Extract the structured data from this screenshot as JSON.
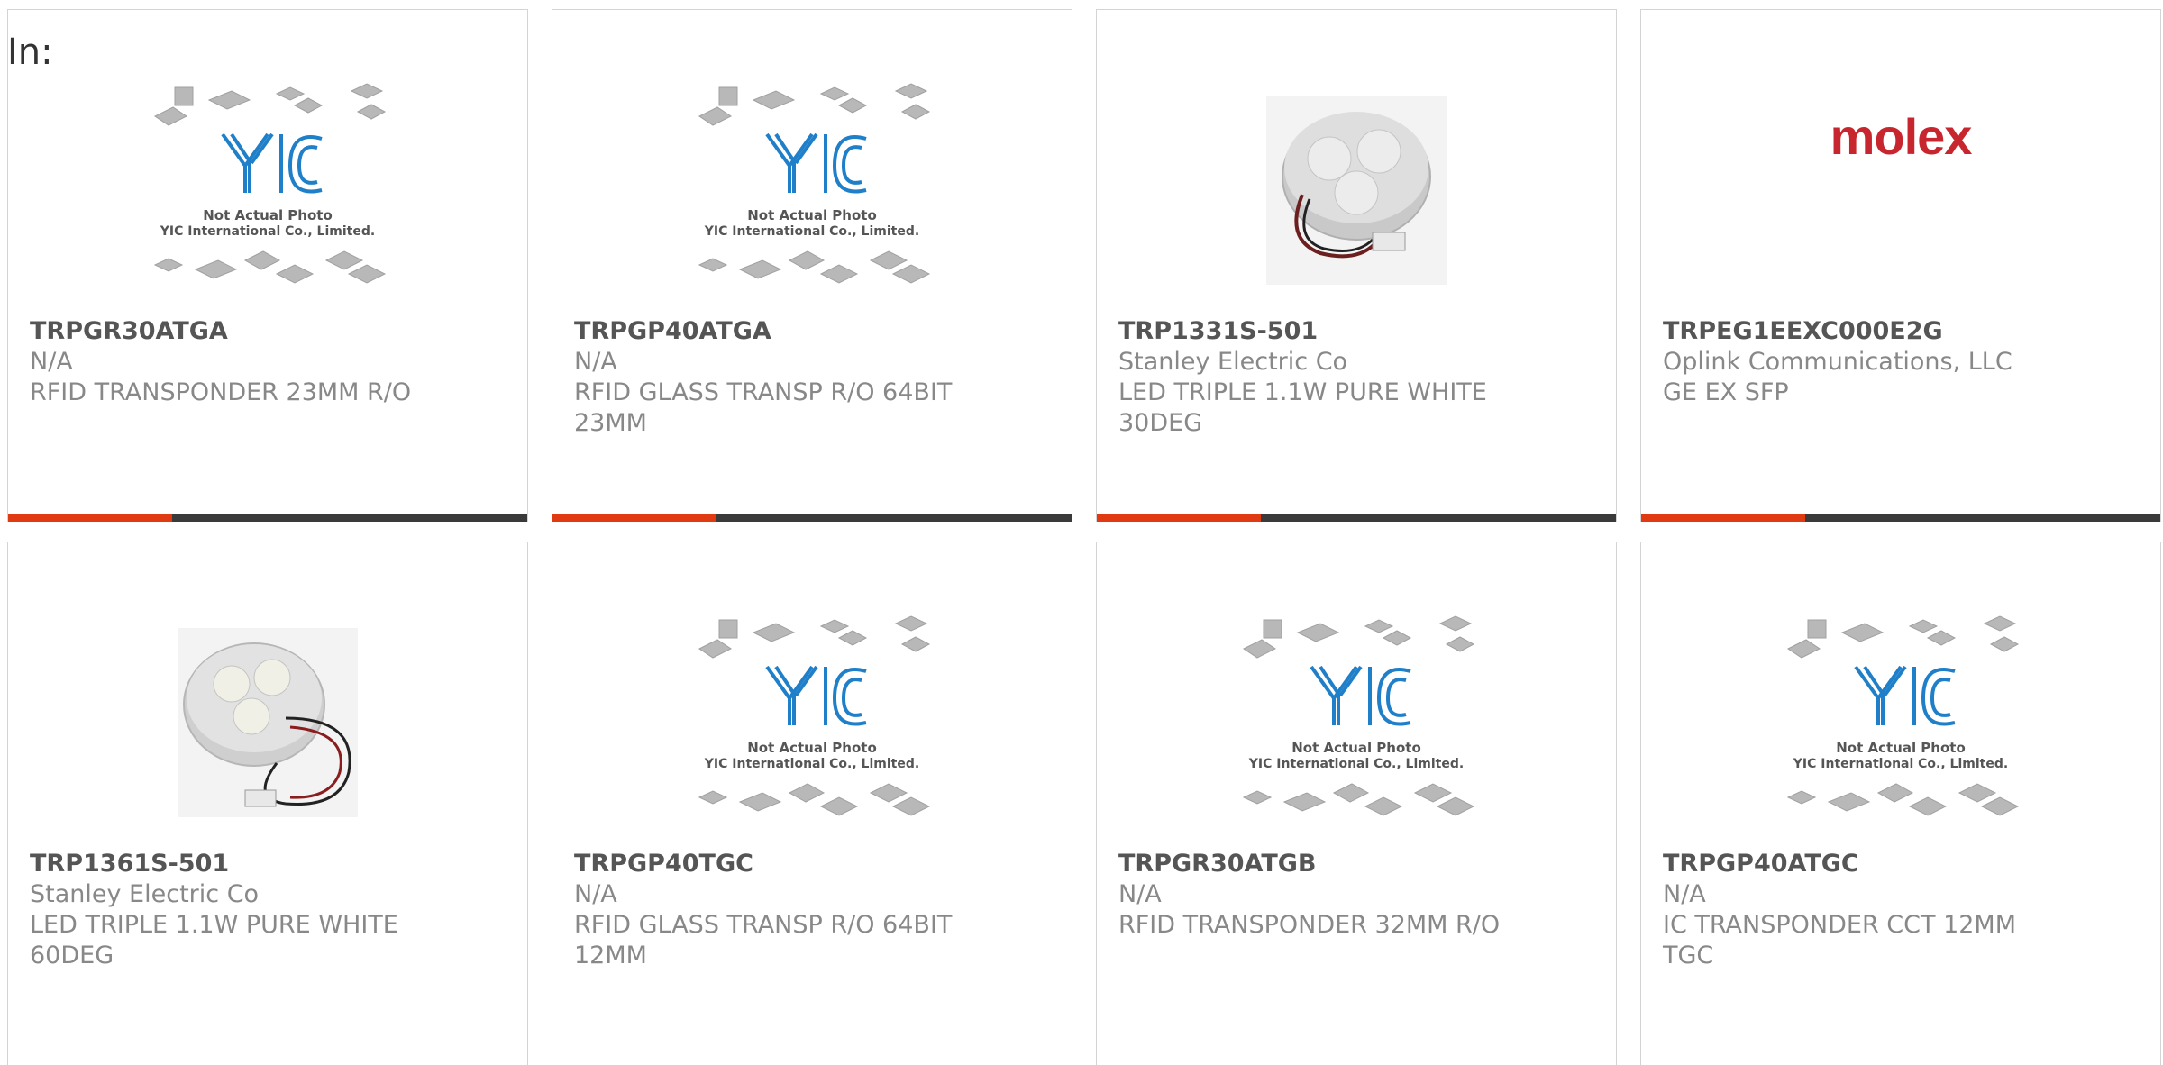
{
  "header": {
    "label": "In:"
  },
  "colors": {
    "accent": "#e03a12",
    "bar": "#3a3a3a",
    "molex_red": "#c8262e",
    "yic_blue": "#1f7fc8"
  },
  "placeholder_image": {
    "line1": "Not Actual Photo",
    "line2": "YIC International Co., Limited."
  },
  "products": [
    {
      "part": "TRPGR30ATGA",
      "manufacturer": "N/A",
      "desc1": "RFID TRANSPONDER 23MM R/O",
      "desc2": "",
      "image": "yic-placeholder"
    },
    {
      "part": "TRPGP40ATGA",
      "manufacturer": "N/A",
      "desc1": "RFID GLASS TRANSP R/O 64BIT",
      "desc2": "23MM",
      "image": "yic-placeholder"
    },
    {
      "part": "TRP1331S-501",
      "manufacturer": "Stanley Electric Co",
      "desc1": "LED TRIPLE 1.1W PURE WHITE",
      "desc2": "30DEG",
      "image": "led-module-photo"
    },
    {
      "part": "TRPEG1EEXC000E2G",
      "manufacturer": "Oplink Communications, LLC",
      "desc1": "GE EX SFP",
      "desc2": "",
      "image": "molex-logo",
      "logo_text": "molex"
    },
    {
      "part": "TRP1361S-501",
      "manufacturer": "Stanley Electric Co",
      "desc1": "LED TRIPLE 1.1W PURE WHITE",
      "desc2": "60DEG",
      "image": "led-module-photo"
    },
    {
      "part": "TRPGP40TGC",
      "manufacturer": "N/A",
      "desc1": "RFID GLASS TRANSP R/O 64BIT",
      "desc2": "12MM",
      "image": "yic-placeholder"
    },
    {
      "part": "TRPGR30ATGB",
      "manufacturer": "N/A",
      "desc1": "RFID TRANSPONDER 32MM R/O",
      "desc2": "",
      "image": "yic-placeholder"
    },
    {
      "part": "TRPGP40ATGC",
      "manufacturer": "N/A",
      "desc1": "IC TRANSPONDER CCT 12MM",
      "desc2": "TGC",
      "image": "yic-placeholder"
    }
  ]
}
